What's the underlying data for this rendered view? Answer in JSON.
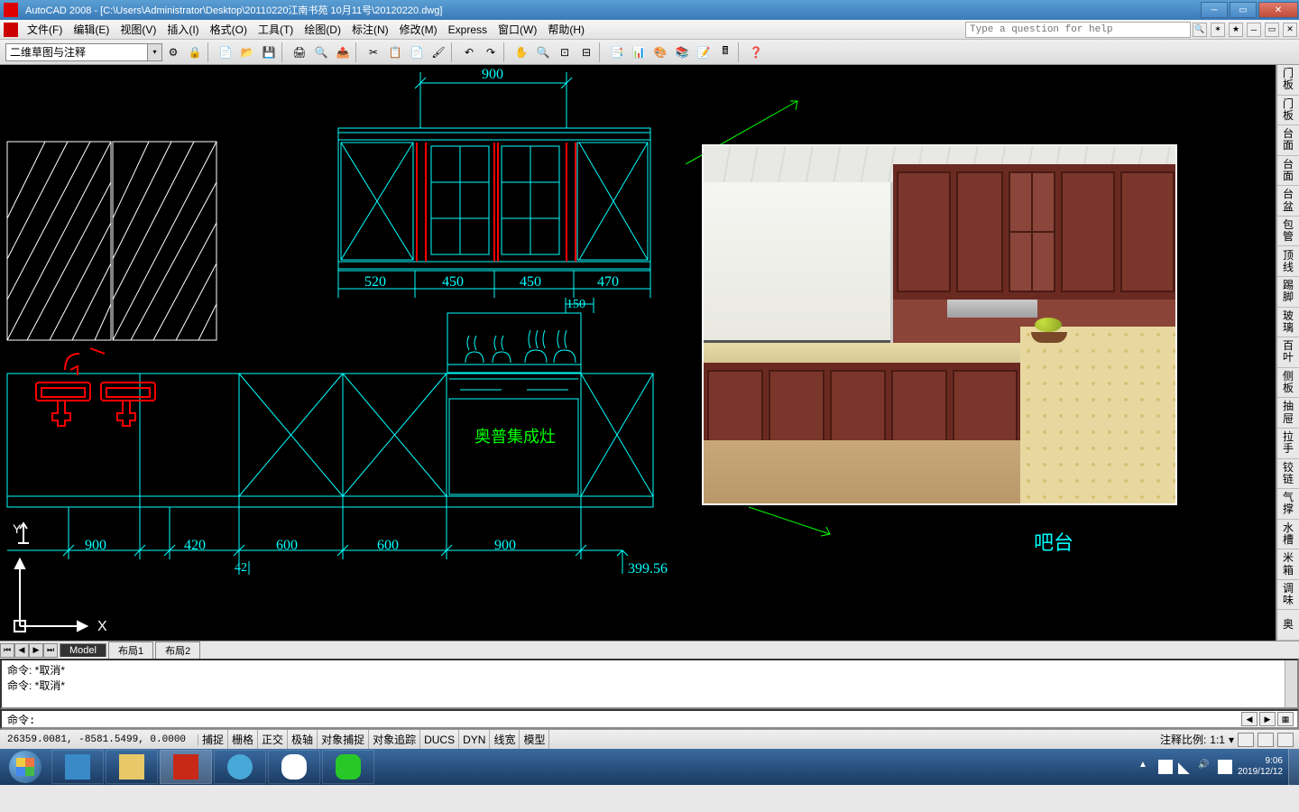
{
  "title": "AutoCAD 2008 - [C:\\Users\\Administrator\\Desktop\\20110220江南书苑 10月11号\\20120220.dwg]",
  "menus": [
    "文件(F)",
    "编辑(E)",
    "视图(V)",
    "插入(I)",
    "格式(O)",
    "工具(T)",
    "绘图(D)",
    "标注(N)",
    "修改(M)",
    "Express",
    "窗口(W)",
    "帮助(H)"
  ],
  "help_placeholder": "Type a question for help",
  "layer_combo": "二维草图与注释",
  "layout_tabs": {
    "active": "Model",
    "others": [
      "布局1",
      "布局2"
    ]
  },
  "cmd_history": [
    "命令: *取消*",
    "命令: *取消*"
  ],
  "cmd_prompt": "命令:",
  "coords": "26359.0081, -8581.5499, 0.0000",
  "status_buttons": [
    "捕捉",
    "栅格",
    "正交",
    "极轴",
    "对象捕捉",
    "对象追踪",
    "DUCS",
    "DYN",
    "线宽",
    "模型"
  ],
  "scale_label": "注释比例:",
  "scale_value": "1:1",
  "palette": [
    "门板",
    "门板",
    "台面",
    "台面",
    "台盆",
    "包管",
    "顶线",
    "踢脚",
    "玻璃",
    "百叶",
    "侧板",
    "抽屉",
    "拉手",
    "铰链",
    "气撑",
    "水槽",
    "米箱",
    "调味",
    "奥"
  ],
  "dimensions": {
    "d900top": "900",
    "d520": "520",
    "d450a": "450",
    "d450b": "450",
    "d470": "470",
    "d150": "150",
    "d900l": "900",
    "d420": "420",
    "d42": "42",
    "d600a": "600",
    "d600b": "600",
    "d900r": "900",
    "d39956": "399.56"
  },
  "annotations": {
    "stove": "奥普集成灶",
    "bar": "吧台"
  },
  "axes": {
    "x": "X",
    "y": "Y"
  },
  "clock": {
    "time": "9:06",
    "date": "2019/12/12"
  }
}
